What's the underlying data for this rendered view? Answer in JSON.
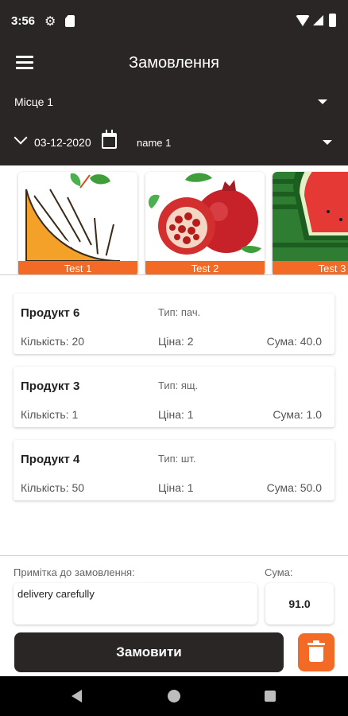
{
  "status_bar": {
    "time": "3:56"
  },
  "header": {
    "title": "Замовлення",
    "place_select": "Місце 1",
    "date": "03-12-2020",
    "name_select": "name 1"
  },
  "categories": [
    {
      "label": "Test 1",
      "icon": "orange-slice-image"
    },
    {
      "label": "Test 2",
      "icon": "pomegranate-image"
    },
    {
      "label": "Test 3",
      "icon": "watermelon-image"
    }
  ],
  "products": [
    {
      "name": "Продукт 6",
      "type": "Тип: пач.",
      "qty": "Кількість: 20",
      "price": "Ціна: 2",
      "sum": "Сума: 40.0"
    },
    {
      "name": "Продукт 3",
      "type": "Тип: ящ.",
      "qty": "Кількість: 1",
      "price": "Ціна: 1",
      "sum": "Сума: 1.0"
    },
    {
      "name": "Продукт 4",
      "type": "Тип: шт.",
      "qty": "Кількість: 50",
      "price": "Ціна: 1",
      "sum": "Сума: 50.0"
    }
  ],
  "footer": {
    "note_label": "Примітка до замовлення:",
    "note_value": "delivery carefully",
    "sum_label": "Сума:",
    "sum_value": "91.0",
    "order_button": "Замовити"
  },
  "colors": {
    "header_bg": "#2b2626",
    "accent": "#f26a25"
  }
}
